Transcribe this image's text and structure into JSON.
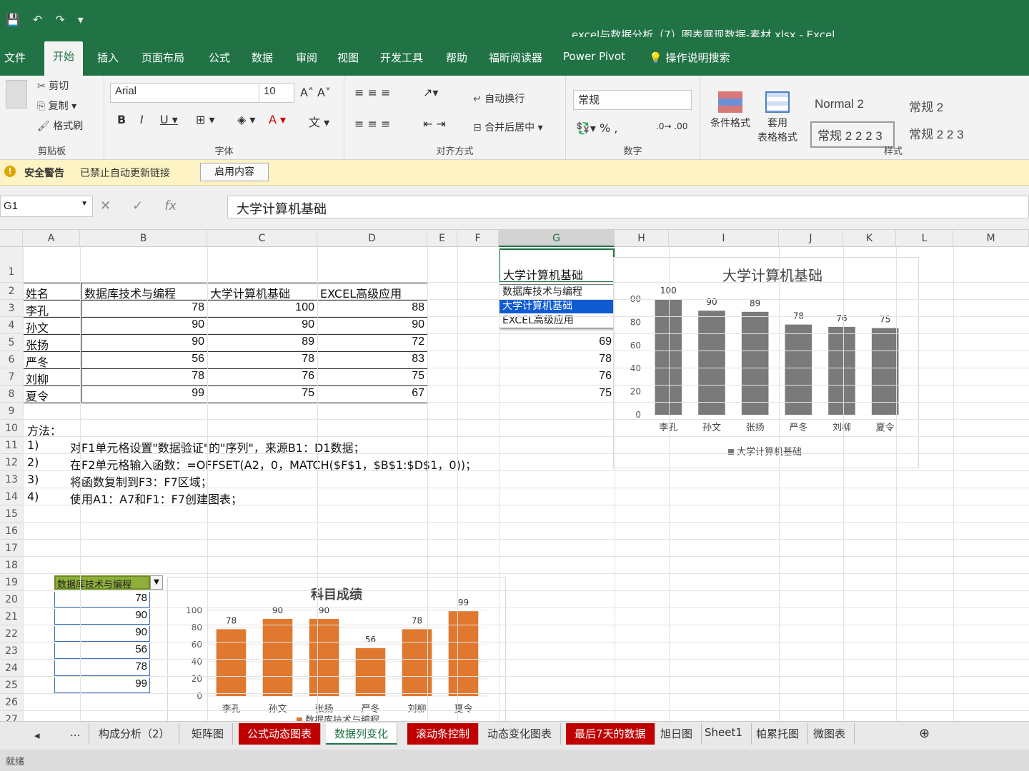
{
  "window": {
    "title": "excel与数据分析（7）图表展现数据-素材.xlsx  -  Excel",
    "qat": [
      "💾",
      "↶",
      "↷",
      "▾"
    ]
  },
  "tabs": [
    "文件",
    "开始",
    "插入",
    "页面布局",
    "公式",
    "数据",
    "审阅",
    "视图",
    "开发工具",
    "帮助",
    "福昕阅读器",
    "Power Pivot",
    "操作说明搜索"
  ],
  "ribbon": {
    "clipboard": {
      "cut": "剪切",
      "copy": "复制",
      "painter": "格式刷",
      "label": "剪贴板"
    },
    "font": {
      "name": "Arial",
      "size": "10",
      "label": "字体"
    },
    "align": {
      "wrap": "自动换行",
      "merge": "合并后居中",
      "label": "对齐方式"
    },
    "number": {
      "format": "常规",
      "label": "数字"
    },
    "styles": {
      "cond": "条件格式",
      "table_a": "套用",
      "table_b": "表格格式",
      "s1": "Normal 2",
      "s2": "常规 2",
      "s3": "常规 2 2 2 3",
      "s4": "常规 2 2 3",
      "label": "样式"
    }
  },
  "security": {
    "title": "安全警告",
    "message": "已禁止自动更新链接",
    "button": "启用内容"
  },
  "formula_bar": {
    "namebox": "G1",
    "content": "大学计算机基础"
  },
  "columns": [
    "A",
    "B",
    "C",
    "D",
    "E",
    "F",
    "G",
    "H",
    "I",
    "J",
    "K",
    "L",
    "M"
  ],
  "rows": [
    "1",
    "2",
    "3",
    "4",
    "5",
    "6",
    "7",
    "8",
    "9",
    "10",
    "11",
    "12",
    "13",
    "14",
    "15",
    "16",
    "17",
    "18",
    "19",
    "20",
    "21",
    "22",
    "23",
    "24",
    "25",
    "26",
    "27"
  ],
  "table": {
    "headers": [
      "姓名",
      "数据库技术与编程",
      "大学计算机基础",
      "EXCEL高级应用"
    ],
    "rows": [
      [
        "李孔",
        "78",
        "100",
        "88"
      ],
      [
        "孙文",
        "90",
        "90",
        "90"
      ],
      [
        "张扬",
        "90",
        "89",
        "72"
      ],
      [
        "严冬",
        "56",
        "78",
        "83"
      ],
      [
        "刘柳",
        "78",
        "76",
        "75"
      ],
      [
        "夏令",
        "99",
        "75",
        "67"
      ]
    ]
  },
  "g_column": {
    "g1": "大学计算机基础",
    "values": [
      "69",
      "78",
      "76",
      "75"
    ]
  },
  "dropdown": {
    "options": [
      "数据库技术与编程",
      "大学计算机基础",
      "EXCEL高级应用"
    ],
    "selected": 1
  },
  "notes": {
    "title": "方法：",
    "items": [
      {
        "num": "1)",
        "text": "对F1单元格设置\"数据验证\"的\"序列\"，来源B1：D1数据；"
      },
      {
        "num": "2)",
        "text": "在F2单元格输入函数：=OFFSET(A2，0，MATCH($F$1，$B$1:$D$1，0))；"
      },
      {
        "num": "3)",
        "text": "将函数复制到F3：F7区域；"
      },
      {
        "num": "4)",
        "text": "使用A1：A7和F1：F7创建图表；"
      }
    ]
  },
  "lower_cells": {
    "header": "数据库技术与编程",
    "values": [
      "78",
      "90",
      "90",
      "56",
      "78",
      "99"
    ]
  },
  "chart_data": [
    {
      "type": "bar",
      "title": "大学计算机基础",
      "categories": [
        "李孔",
        "孙文",
        "张扬",
        "严冬",
        "刘柳",
        "夏令"
      ],
      "series": [
        {
          "name": "大学计算机基础",
          "values": [
            100,
            90,
            89,
            78,
            76,
            75
          ]
        }
      ],
      "ylim": [
        0,
        100
      ],
      "yticks": [
        "0",
        "20",
        "40",
        "60",
        "80",
        "00"
      ],
      "color": "#7a7a7a",
      "legend": "bottom",
      "grid": false
    },
    {
      "type": "bar",
      "title": "科目成绩",
      "categories": [
        "李孔",
        "孙文",
        "张扬",
        "严冬",
        "刘柳",
        "夏令"
      ],
      "series": [
        {
          "name": "数据库技术与编程",
          "values": [
            78,
            90,
            90,
            56,
            78,
            99
          ]
        }
      ],
      "ylim": [
        0,
        100
      ],
      "yticks": [
        "0",
        "20",
        "40",
        "60",
        "80",
        "100"
      ],
      "color": "#e0782f",
      "legend": "bottom",
      "grid": true
    }
  ],
  "sheet_tabs": [
    {
      "name": "...",
      "style": ""
    },
    {
      "name": "构成分析（2）",
      "style": ""
    },
    {
      "name": "矩阵图",
      "style": ""
    },
    {
      "name": "公式动态图表",
      "style": "red"
    },
    {
      "name": "数据列变化",
      "style": "active"
    },
    {
      "name": "滚动条控制",
      "style": "red"
    },
    {
      "name": "动态变化图表",
      "style": ""
    },
    {
      "name": "最后7天的数据",
      "style": "red"
    },
    {
      "name": "旭日图",
      "style": ""
    },
    {
      "name": "Sheet1",
      "style": ""
    },
    {
      "name": "帕累托图",
      "style": ""
    },
    {
      "name": "微图表",
      "style": ""
    }
  ],
  "status": {
    "ready": "就绪"
  }
}
